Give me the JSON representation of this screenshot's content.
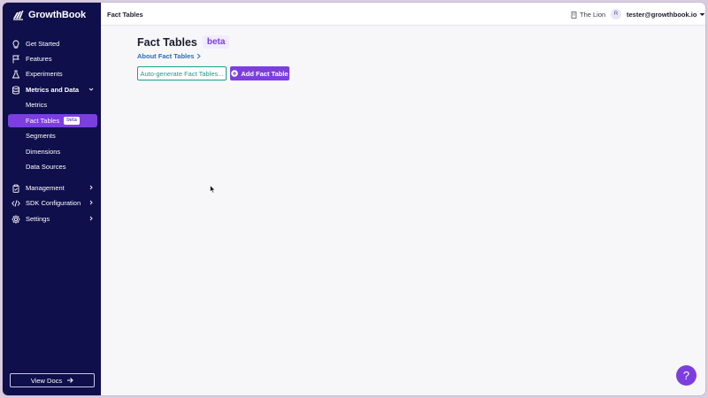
{
  "brand": {
    "name": "GrowthBook"
  },
  "sidebar": {
    "items": [
      {
        "label": "Get Started",
        "icon": "lightbulb-icon"
      },
      {
        "label": "Features",
        "icon": "flag-icon"
      },
      {
        "label": "Experiments",
        "icon": "flask-icon"
      },
      {
        "label": "Metrics and Data",
        "icon": "database-icon",
        "expanded": true,
        "children": [
          {
            "label": "Metrics"
          },
          {
            "label": "Fact Tables",
            "badge": "beta",
            "active": true
          },
          {
            "label": "Segments"
          },
          {
            "label": "Dimensions"
          },
          {
            "label": "Data Sources"
          }
        ]
      },
      {
        "label": "Management",
        "icon": "clipboard-icon"
      },
      {
        "label": "SDK Configuration",
        "icon": "code-icon"
      },
      {
        "label": "Settings",
        "icon": "gear-icon"
      }
    ],
    "view_docs": "View Docs"
  },
  "topbar": {
    "title": "Fact Tables",
    "org_name": "The Lion",
    "avatar_initial": "R",
    "user_email": "tester@growthbook.io"
  },
  "main": {
    "title": "Fact Tables",
    "title_badge": "beta",
    "about_link": "About Fact Tables",
    "auto_generate_button": "Auto-generate Fact Tables...",
    "add_button": "Add Fact Table"
  },
  "help": {
    "label": "?"
  },
  "colors": {
    "sidebar_bg": "#0f0f4c",
    "accent": "#7c3ee0",
    "teal": "#1a9e8a",
    "link": "#2a6db6"
  }
}
